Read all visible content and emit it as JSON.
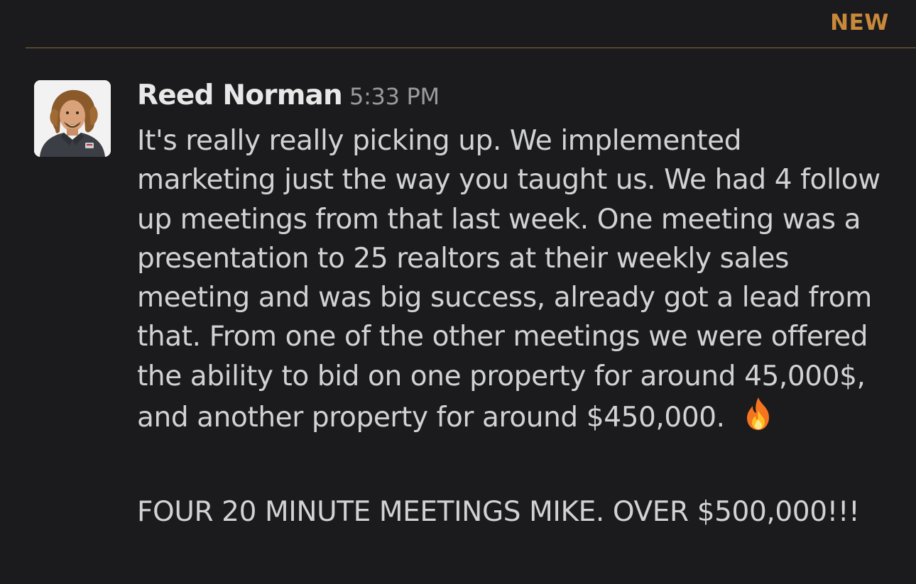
{
  "divider": {
    "new_label": "NEW",
    "color": "#8a6d3b",
    "label_color": "#c9893a"
  },
  "message": {
    "author": "Reed Norman",
    "timestamp": "5:33 PM",
    "avatar_icon": "user-photo-avatar",
    "paragraph_1": "It's really really picking up. We implemented marketing just the way you taught us. We had 4 follow up meetings from that last week. One meeting was a presentation to 25 realtors at their weekly sales meeting and was big success, already got a lead from that. From one of the other meetings we were offered the ability to bid on one property for around 45,000$, and another property for around $450,000.",
    "emoji": "fire-icon",
    "paragraph_2": "FOUR 20 MINUTE MEETINGS MIKE. OVER $500,000!!!"
  },
  "colors": {
    "background": "#1b1a1d",
    "text": "#d1d2d3",
    "author": "#e8e8e8",
    "timestamp": "#9a9b9d"
  }
}
